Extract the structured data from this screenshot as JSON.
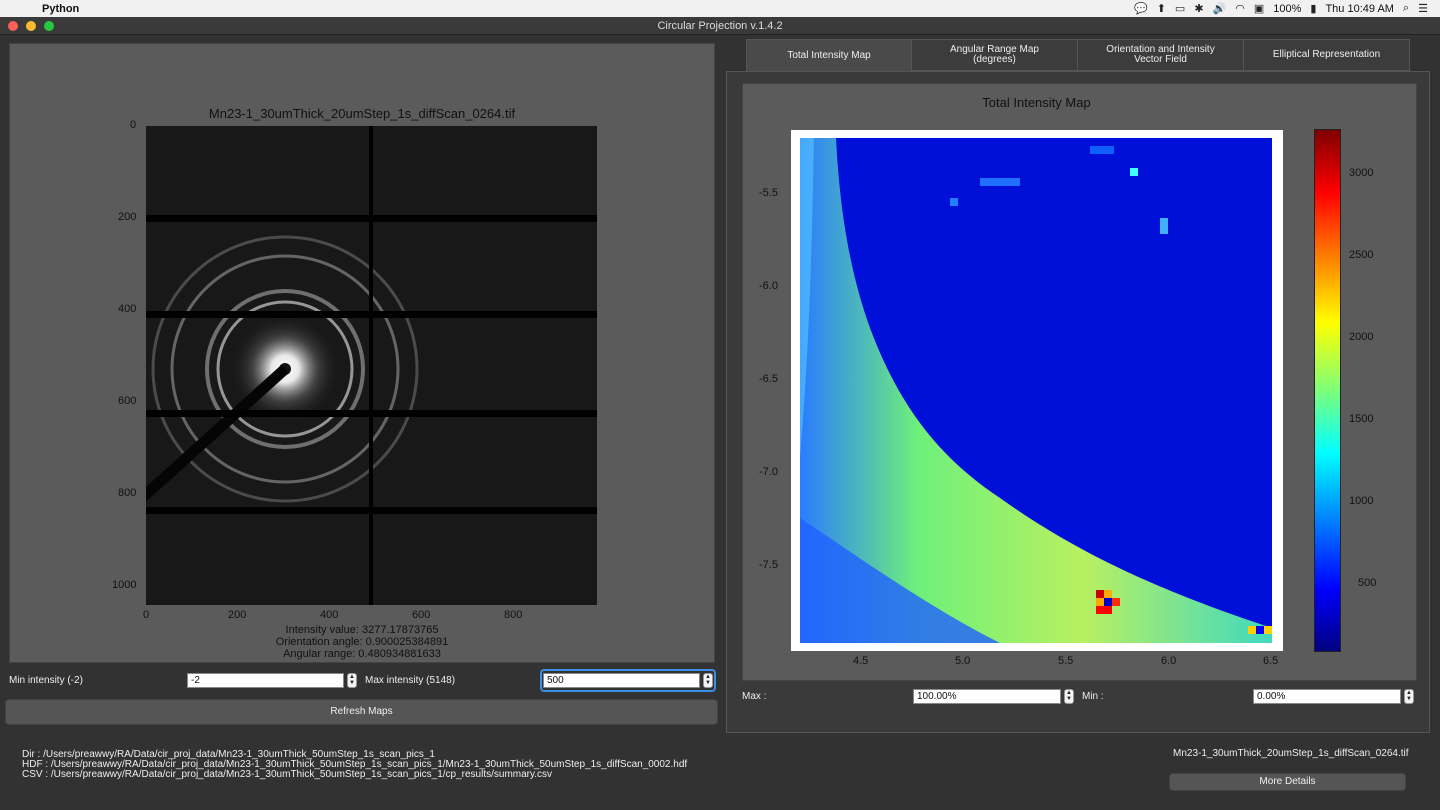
{
  "menubar": {
    "app_name": "Python",
    "battery": "100%",
    "clock": "Thu 10:49 AM"
  },
  "window": {
    "title": "Circular Projection v.1.4.2"
  },
  "left": {
    "plot_title": "Mn23-1_30umThick_20umStep_1s_diffScan_0264.tif",
    "y_ticks": [
      "0",
      "200",
      "400",
      "600",
      "800",
      "1000"
    ],
    "x_ticks": [
      "0",
      "200",
      "400",
      "600",
      "800"
    ],
    "intensity_value": "Intensity value: 3277.17873765",
    "orientation_angle": "Orientation angle: 0.900025384891",
    "angular_range": "Angular range: 0.480934881633"
  },
  "controls": {
    "min_label": "Min intensity (-2)",
    "min_value": "-2",
    "max_label": "Max intensity (5148)",
    "max_value": "500",
    "refresh_label": "Refresh Maps"
  },
  "paths": {
    "dir": "Dir : /Users/preawwy/RA/Data/cir_proj_data/Mn23-1_30umThick_50umStep_1s_scan_pics_1",
    "hdf": "HDF : /Users/preawwy/RA/Data/cir_proj_data/Mn23-1_30umThick_50umStep_1s_scan_pics_1/Mn23-1_30umThick_50umStep_1s_diffScan_0002.hdf",
    "csv": "CSV : /Users/preawwy/RA/Data/cir_proj_data/Mn23-1_30umThick_50umStep_1s_scan_pics_1/cp_results/summary.csv"
  },
  "tabs": [
    {
      "line1": "Total Intensity Map",
      "line2": ""
    },
    {
      "line1": "Angular Range Map",
      "line2": "(degrees)"
    },
    {
      "line1": "Orientation and Intensity",
      "line2": "Vector Field"
    },
    {
      "line1": "Elliptical Representation",
      "line2": ""
    }
  ],
  "right": {
    "map_title": "Total Intensity Map",
    "y_ticks": [
      "-5.5",
      "-6.0",
      "-6.5",
      "-7.0",
      "-7.5"
    ],
    "x_ticks": [
      "4.5",
      "5.0",
      "5.5",
      "6.0",
      "6.5"
    ],
    "colorbar_ticks": [
      "3000",
      "2500",
      "2000",
      "1500",
      "1000",
      "500"
    ],
    "max_label": "Max :",
    "max_value": "100.00%",
    "min_label": "Min :",
    "min_value": "0.00%"
  },
  "footer": {
    "filename": "Mn23-1_30umThick_20umStep_1s_diffScan_0264.tif",
    "details_label": "More Details"
  }
}
